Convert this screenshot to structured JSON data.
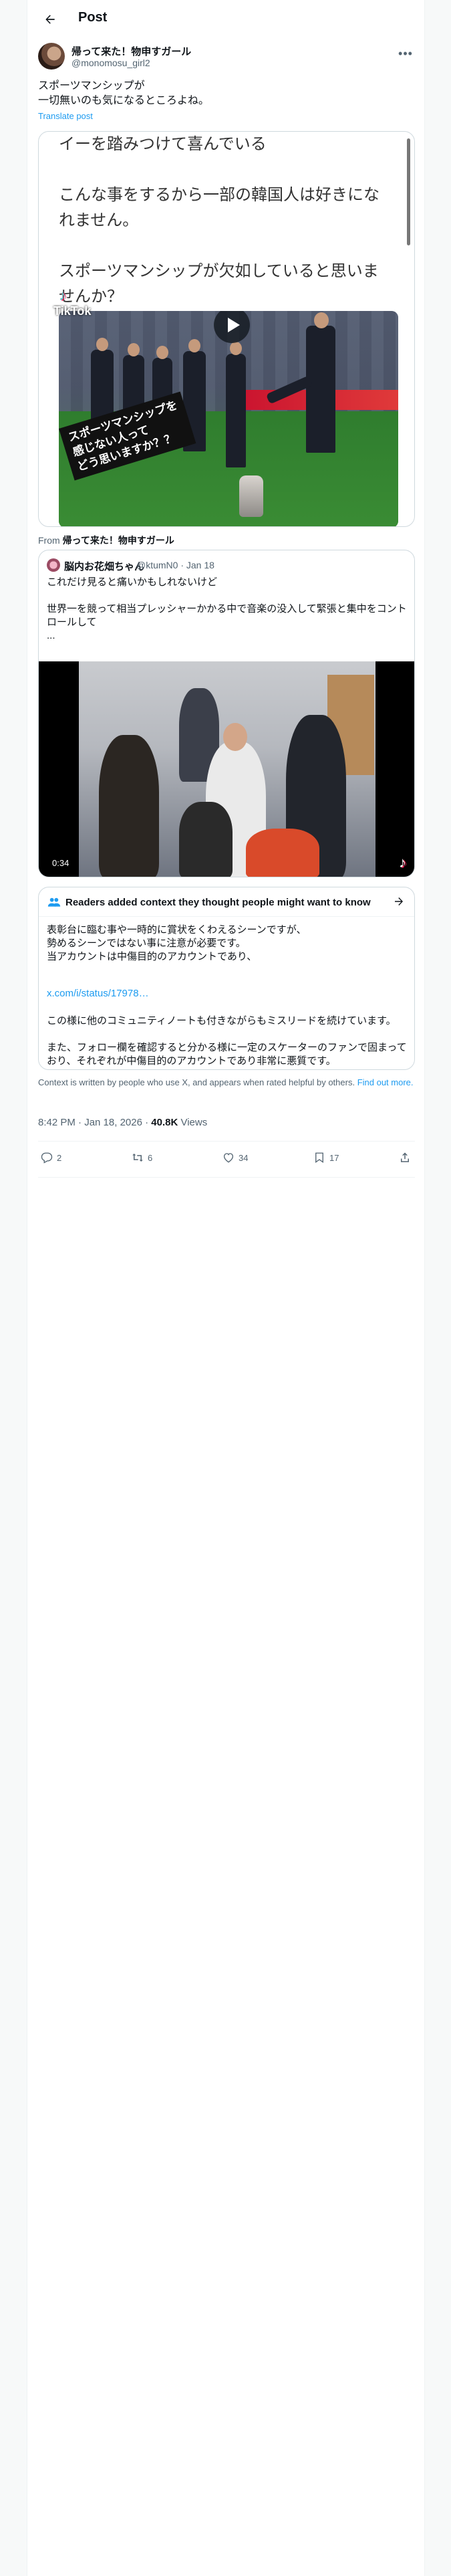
{
  "header": {
    "title": "Post"
  },
  "author": {
    "name": "帰って来た！物申すガール",
    "handle": "@monomosu_girl2"
  },
  "post": {
    "text": "スポーツマンシップが\n一切無いのも気になるところよね。",
    "translate_label": "Translate post"
  },
  "media": {
    "image_text": "イーを踏みつけて喜んでいる\n\nこんな事をするから一部の韓国人は好きになれません。\n\nスポーツマンシップが欠如していると思いませんか？",
    "tiktok_label": "TikTok",
    "overlay_caption": "スポーツマンシップを\n感じない人って\nどう思いますか？？"
  },
  "from": {
    "prefix": "From",
    "name": "帰って来た！物申すガール"
  },
  "quote": {
    "name": "脳内お花畑ちゃん",
    "handle": "@ktumN0 · Jan 18",
    "text": "これだけ見ると痛いかもしれないけど\n\n世界一を競って相当プレッシャーかかる中で音楽の没入して緊張と集中をコントロールして\n...",
    "duration": "0:34"
  },
  "note": {
    "title": "Readers added context they thought people might want to know",
    "body": "表彰台に臨む事や一時的に賞状をくわえるシーンですが、\n勢めるシーンではない事に注意が必要です。\n当アカウントは中傷目的のアカウントであり、",
    "link": "x.com/i/status/17978…",
    "body2": "この様に他のコミュニティノートも付きながらもミスリードを続けています。\n\nまた、フォロー欄を確認すると分かる様に一定のスケーターのファンで固まっており、それぞれが中傷目的のアカウントであり非常に悪質です。"
  },
  "context": {
    "text": "Context is written by people who use X, and appears when rated helpful by others.",
    "link": "Find out more."
  },
  "meta": {
    "time": "8:42 PM · Jan 18, 2026 · ",
    "views_count": "40.8K",
    "views_label": " Views"
  },
  "actions": {
    "replies": "2",
    "reposts": "6",
    "likes": "34",
    "bookmarks": "17"
  },
  "colors": {
    "accent": "#1d9bf0",
    "text": "#0f1419",
    "muted": "#536471",
    "border": "#cfd9de"
  }
}
